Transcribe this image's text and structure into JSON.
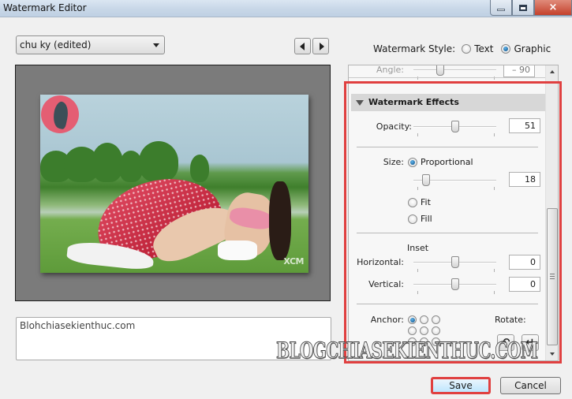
{
  "window": {
    "title": "Watermark Editor",
    "controls": {
      "minimize": "minimize-icon",
      "maximize": "maximize-icon",
      "close": "×"
    }
  },
  "preset": {
    "selected": "chu ky (edited)"
  },
  "nav": {
    "prev_icon": "triangle-left-icon",
    "next_icon": "triangle-right-icon"
  },
  "watermark_style": {
    "label": "Watermark Style:",
    "options": [
      {
        "label": "Text",
        "selected": false
      },
      {
        "label": "Graphic",
        "selected": true
      }
    ]
  },
  "preview": {
    "overlay_text": "XCM"
  },
  "text_field": {
    "value": "Blohchiasekienthuc.com"
  },
  "panel": {
    "angle": {
      "label": "Angle:",
      "value": "– 90",
      "slider_fraction": 0.3
    },
    "section_title": "Watermark Effects",
    "opacity": {
      "label": "Opacity:",
      "value": "51",
      "slider_fraction": 0.51
    },
    "size": {
      "label": "Size:",
      "options": [
        {
          "label": "Proportional",
          "selected": true
        },
        {
          "label": "Fit",
          "selected": false
        },
        {
          "label": "Fill",
          "selected": false
        }
      ],
      "value": "18",
      "slider_fraction": 0.12
    },
    "inset": {
      "title": "Inset",
      "horizontal": {
        "label": "Horizontal:",
        "value": "0",
        "slider_fraction": 0.5
      },
      "vertical": {
        "label": "Vertical:",
        "value": "0",
        "slider_fraction": 0.5
      }
    },
    "anchor": {
      "label": "Anchor:",
      "grid": [
        true,
        false,
        false,
        false,
        false,
        false,
        false,
        false,
        false
      ]
    },
    "rotate": {
      "label": "Rotate:",
      "ccw_icon": "↶",
      "cw_icon": "↵"
    }
  },
  "overlay_watermark": "BLOGCHIASEKIENTHUC.COM",
  "footer": {
    "save_label": "Save",
    "cancel_label": "Cancel"
  }
}
